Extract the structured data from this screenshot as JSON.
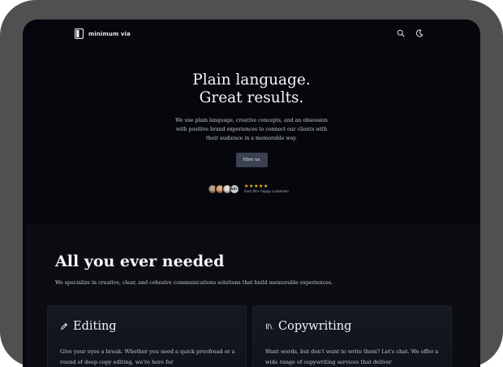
{
  "nav": {
    "brand": "minimum via",
    "icons": [
      "logo-icon",
      "search-icon",
      "moon-icon"
    ]
  },
  "hero": {
    "title_line1": "Plain language.",
    "title_line2": "Great results.",
    "description": "We use plain language, creative concepts, and an obsession with positive brand experiences to connect our clients with their audience in a memorable way.",
    "cta_label": "Hire us"
  },
  "social_proof": {
    "avatar_count_label": "64+",
    "stars": "★★★★★",
    "caption": "from 64+ happy customers"
  },
  "features": {
    "title": "All you ever needed",
    "subtitle": "We specialize in creative, clear, and cohesive communications solutions that build memorable experiences.",
    "cards": [
      {
        "icon": "pencil-icon",
        "title": "Editing",
        "body": "Give your eyes a break. Whether you need a quick proofread or a round of deep copy editing, we're here for"
      },
      {
        "icon": "library-icon",
        "title": "Copywriting",
        "body": "Want words, but don't want to write them? Let's chat. We offer a wide range of copywriting services that deliver"
      }
    ]
  },
  "colors": {
    "background": "#05070d",
    "section_background": "#0b0d13",
    "button": "#3a4150",
    "stars": "#f4c21b",
    "device_frame": "#505050"
  }
}
